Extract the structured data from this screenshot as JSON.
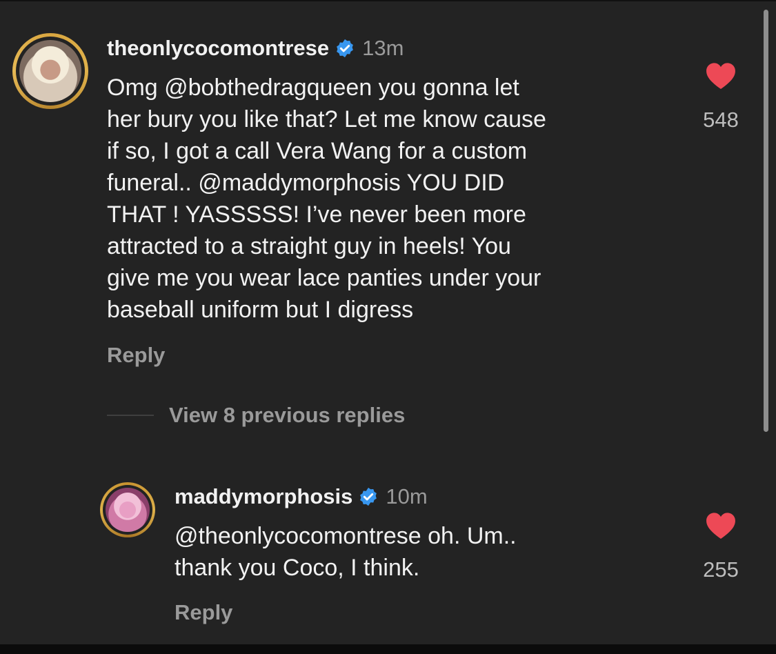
{
  "comment": {
    "username": "theonlycocomontrese",
    "time": "13m",
    "lines": [
      "Omg @bobthedragqueen  you gonna let",
      "her bury you like that? Let me know cause",
      "if so, I got a call Vera Wang for a custom",
      "funeral.. @maddymorphosis  YOU DID",
      "THAT !  YASSSSS!  I’ve never been more",
      "attracted to a straight guy in heels! You",
      "give me you wear lace panties under your",
      "baseball uniform but I digress"
    ],
    "reply_label": "Reply",
    "likes": "548",
    "liked": true
  },
  "view_replies_label": "View 8 previous replies",
  "reply": {
    "username": "maddymorphosis",
    "time": "10m",
    "lines": [
      "@theonlycocomontrese oh. Um..",
      "thank you Coco, I think."
    ],
    "reply_label": "Reply",
    "likes": "255",
    "liked": true
  },
  "colors": {
    "background": "#232323",
    "heart": "#ed4956",
    "verified": "#3897f0",
    "muted_text": "#9a9a9a"
  },
  "icons": {
    "verified": "verified-badge-icon",
    "like": "heart-icon"
  }
}
